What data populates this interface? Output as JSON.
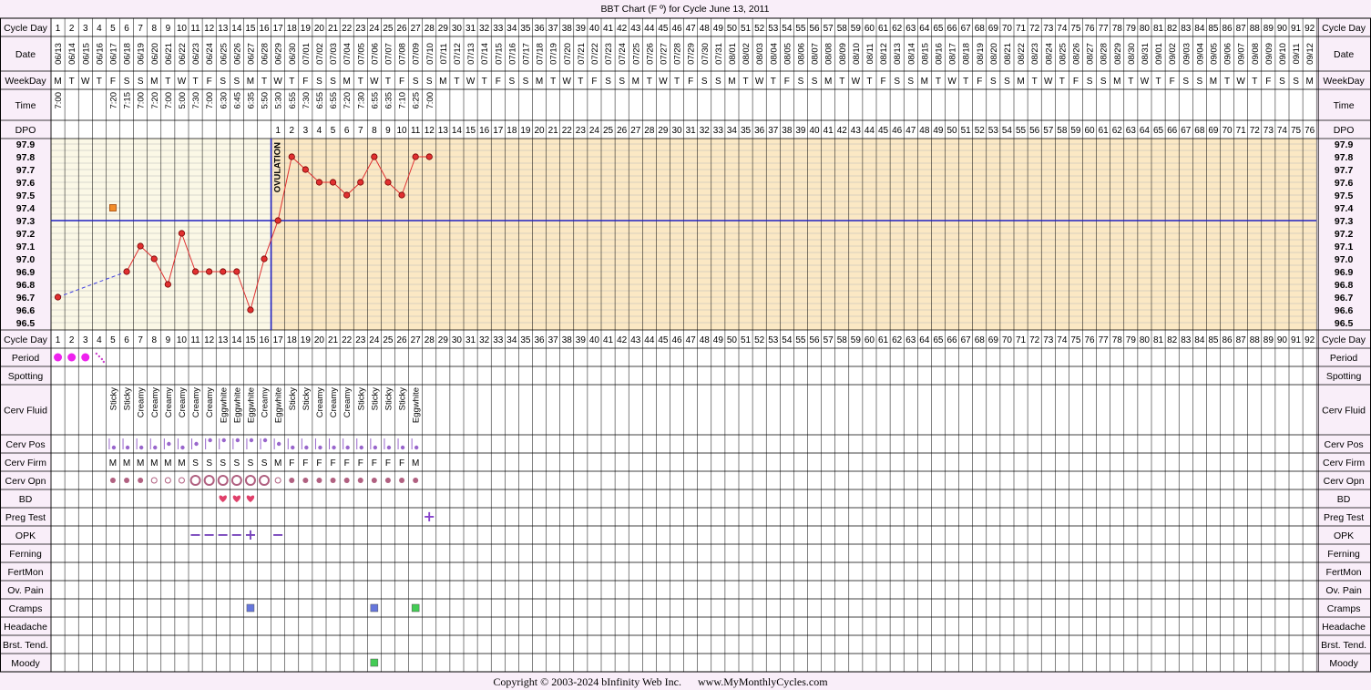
{
  "chart_data": {
    "type": "line",
    "title": "BBT Chart (F º) for Cycle June 13, 2011",
    "ylim": [
      96.5,
      97.9
    ],
    "y_ticks": [
      "97.9",
      "97.8",
      "97.7",
      "97.6",
      "97.5",
      "97.4",
      "97.3",
      "97.2",
      "97.1",
      "97.0",
      "96.9",
      "96.8",
      "96.7",
      "96.6",
      "96.5"
    ],
    "num_days": 92,
    "dates": [
      "06/13",
      "06/14",
      "06/15",
      "06/16",
      "06/17",
      "06/18",
      "06/19",
      "06/20",
      "06/21",
      "06/22",
      "06/23",
      "06/24",
      "06/25",
      "06/26",
      "06/27",
      "06/28",
      "06/29",
      "06/30",
      "07/01",
      "07/02",
      "07/03",
      "07/04",
      "07/05",
      "07/06",
      "07/07",
      "07/08",
      "07/09",
      "07/10",
      "07/11",
      "07/12",
      "07/13",
      "07/14",
      "07/15",
      "07/16",
      "07/17",
      "07/18",
      "07/19",
      "07/20",
      "07/21",
      "07/22",
      "07/23",
      "07/24",
      "07/25",
      "07/26",
      "07/27",
      "07/28",
      "07/29",
      "07/30",
      "07/31",
      "08/01",
      "08/02",
      "08/03",
      "08/04",
      "08/05",
      "08/06",
      "08/07",
      "08/08",
      "08/09",
      "08/10",
      "08/11",
      "08/12",
      "08/13",
      "08/14",
      "08/15",
      "08/16",
      "08/17",
      "08/18",
      "08/19",
      "08/20",
      "08/21",
      "08/22",
      "08/23",
      "08/24",
      "08/25",
      "08/26",
      "08/27",
      "08/28",
      "08/29",
      "08/30",
      "08/31",
      "09/01",
      "09/02",
      "09/03",
      "09/04",
      "09/05",
      "09/06",
      "09/07",
      "09/08",
      "09/09",
      "09/10",
      "09/11",
      "09/12"
    ],
    "weekday_cycle": [
      "M",
      "T",
      "W",
      "T",
      "F",
      "S",
      "S"
    ],
    "times": [
      "7:00",
      "",
      "",
      "",
      "7:20",
      "7:15",
      "7:00",
      "7:20",
      "7:00",
      "5:00",
      "7:30",
      "7:00",
      "6:30",
      "6:45",
      "6:35",
      "5:50",
      "5:30",
      "6:55",
      "7:30",
      "6:55",
      "6:55",
      "7:20",
      "7:30",
      "6:55",
      "6:35",
      "7:10",
      "6:25",
      "7:00"
    ],
    "dpo_start_day": 17,
    "dpo_max": 76,
    "temperatures": [
      {
        "day": 1,
        "temp": 96.7
      },
      {
        "day": 6,
        "temp": 96.9
      },
      {
        "day": 7,
        "temp": 97.1
      },
      {
        "day": 8,
        "temp": 97.0
      },
      {
        "day": 9,
        "temp": 96.8
      },
      {
        "day": 10,
        "temp": 97.2
      },
      {
        "day": 11,
        "temp": 96.9
      },
      {
        "day": 12,
        "temp": 96.9
      },
      {
        "day": 13,
        "temp": 96.9
      },
      {
        "day": 14,
        "temp": 96.9
      },
      {
        "day": 15,
        "temp": 96.6
      },
      {
        "day": 16,
        "temp": 97.0
      },
      {
        "day": 17,
        "temp": 97.3
      },
      {
        "day": 18,
        "temp": 97.8
      },
      {
        "day": 19,
        "temp": 97.7
      },
      {
        "day": 20,
        "temp": 97.6
      },
      {
        "day": 21,
        "temp": 97.6
      },
      {
        "day": 22,
        "temp": 97.5
      },
      {
        "day": 23,
        "temp": 97.6
      },
      {
        "day": 24,
        "temp": 97.8
      },
      {
        "day": 25,
        "temp": 97.6
      },
      {
        "day": 26,
        "temp": 97.5
      },
      {
        "day": 27,
        "temp": 97.8
      },
      {
        "day": 28,
        "temp": 97.8
      }
    ],
    "discarded": [
      {
        "day": 5,
        "temp": 97.4
      }
    ],
    "coverline": 97.3,
    "ovulation_day": 16,
    "ovulation_label": "OVULATION",
    "colors": {
      "follicular": "#fbf8e6",
      "luteal": "#fbe8c4",
      "line": "#e03030",
      "coverline": "#2020c0",
      "header": "#f9eef9",
      "dashed": "#4040e0"
    }
  },
  "labels": {
    "cycle_day": "Cycle Day",
    "date": "Date",
    "weekday": "WeekDay",
    "time": "Time",
    "dpo": "DPO",
    "period": "Period",
    "spotting": "Spotting",
    "cerv_fluid": "Cerv Fluid",
    "cerv_pos": "Cerv Pos",
    "cerv_firm": "Cerv Firm",
    "cerv_opn": "Cerv Opn",
    "bd": "BD",
    "preg_test": "Preg Test",
    "opk": "OPK",
    "ferning": "Ferning",
    "fertmon": "FertMon",
    "ov_pain": "Ov. Pain",
    "cramps": "Cramps",
    "headache": "Headache",
    "brst_tend": "Brst. Tend.",
    "moody": "Moody"
  },
  "observations": {
    "period": [
      {
        "day": 1,
        "kind": "heavy"
      },
      {
        "day": 2,
        "kind": "heavy"
      },
      {
        "day": 3,
        "kind": "heavy"
      },
      {
        "day": 4,
        "kind": "spot"
      }
    ],
    "cerv_fluid": [
      {
        "day": 5,
        "v": "Sticky"
      },
      {
        "day": 6,
        "v": "Sticky"
      },
      {
        "day": 7,
        "v": "Creamy"
      },
      {
        "day": 8,
        "v": "Creamy"
      },
      {
        "day": 9,
        "v": "Creamy"
      },
      {
        "day": 10,
        "v": "Creamy"
      },
      {
        "day": 11,
        "v": "Creamy"
      },
      {
        "day": 12,
        "v": "Creamy"
      },
      {
        "day": 13,
        "v": "Eggwhite"
      },
      {
        "day": 14,
        "v": "Eggwhite"
      },
      {
        "day": 15,
        "v": "Eggwhite"
      },
      {
        "day": 16,
        "v": "Creamy"
      },
      {
        "day": 17,
        "v": "Eggwhite"
      },
      {
        "day": 18,
        "v": "Sticky"
      },
      {
        "day": 19,
        "v": "Sticky"
      },
      {
        "day": 20,
        "v": "Creamy"
      },
      {
        "day": 21,
        "v": "Creamy"
      },
      {
        "day": 22,
        "v": "Creamy"
      },
      {
        "day": 23,
        "v": "Sticky"
      },
      {
        "day": 24,
        "v": "Sticky"
      },
      {
        "day": 25,
        "v": "Sticky"
      },
      {
        "day": 26,
        "v": "Sticky"
      },
      {
        "day": 27,
        "v": "Eggwhite"
      }
    ],
    "cerv_pos": [
      {
        "day": 5,
        "v": "low"
      },
      {
        "day": 6,
        "v": "low"
      },
      {
        "day": 7,
        "v": "low"
      },
      {
        "day": 8,
        "v": "low"
      },
      {
        "day": 9,
        "v": "mid"
      },
      {
        "day": 10,
        "v": "low"
      },
      {
        "day": 11,
        "v": "mid"
      },
      {
        "day": 12,
        "v": "high"
      },
      {
        "day": 13,
        "v": "high"
      },
      {
        "day": 14,
        "v": "high"
      },
      {
        "day": 15,
        "v": "high"
      },
      {
        "day": 16,
        "v": "high"
      },
      {
        "day": 17,
        "v": "mid"
      },
      {
        "day": 18,
        "v": "low"
      },
      {
        "day": 19,
        "v": "low"
      },
      {
        "day": 20,
        "v": "low"
      },
      {
        "day": 21,
        "v": "low"
      },
      {
        "day": 22,
        "v": "low"
      },
      {
        "day": 23,
        "v": "low"
      },
      {
        "day": 24,
        "v": "low"
      },
      {
        "day": 25,
        "v": "low"
      },
      {
        "day": 26,
        "v": "low"
      },
      {
        "day": 27,
        "v": "low"
      }
    ],
    "cerv_firm": [
      {
        "day": 5,
        "v": "M"
      },
      {
        "day": 6,
        "v": "M"
      },
      {
        "day": 7,
        "v": "M"
      },
      {
        "day": 8,
        "v": "M"
      },
      {
        "day": 9,
        "v": "M"
      },
      {
        "day": 10,
        "v": "M"
      },
      {
        "day": 11,
        "v": "S"
      },
      {
        "day": 12,
        "v": "S"
      },
      {
        "day": 13,
        "v": "S"
      },
      {
        "day": 14,
        "v": "S"
      },
      {
        "day": 15,
        "v": "S"
      },
      {
        "day": 16,
        "v": "S"
      },
      {
        "day": 17,
        "v": "M"
      },
      {
        "day": 18,
        "v": "F"
      },
      {
        "day": 19,
        "v": "F"
      },
      {
        "day": 20,
        "v": "F"
      },
      {
        "day": 21,
        "v": "F"
      },
      {
        "day": 22,
        "v": "F"
      },
      {
        "day": 23,
        "v": "F"
      },
      {
        "day": 24,
        "v": "F"
      },
      {
        "day": 25,
        "v": "F"
      },
      {
        "day": 26,
        "v": "F"
      },
      {
        "day": 27,
        "v": "M"
      }
    ],
    "cerv_opn": [
      {
        "day": 5,
        "v": "closed"
      },
      {
        "day": 6,
        "v": "closed"
      },
      {
        "day": 7,
        "v": "closed"
      },
      {
        "day": 8,
        "v": "medium"
      },
      {
        "day": 9,
        "v": "medium"
      },
      {
        "day": 10,
        "v": "medium"
      },
      {
        "day": 11,
        "v": "open"
      },
      {
        "day": 12,
        "v": "open"
      },
      {
        "day": 13,
        "v": "open"
      },
      {
        "day": 14,
        "v": "open"
      },
      {
        "day": 15,
        "v": "open"
      },
      {
        "day": 16,
        "v": "open"
      },
      {
        "day": 17,
        "v": "medium"
      },
      {
        "day": 18,
        "v": "closed"
      },
      {
        "day": 19,
        "v": "closed"
      },
      {
        "day": 20,
        "v": "closed"
      },
      {
        "day": 21,
        "v": "closed"
      },
      {
        "day": 22,
        "v": "closed"
      },
      {
        "day": 23,
        "v": "closed"
      },
      {
        "day": 24,
        "v": "closed"
      },
      {
        "day": 25,
        "v": "closed"
      },
      {
        "day": 26,
        "v": "closed"
      },
      {
        "day": 27,
        "v": "closed"
      }
    ],
    "bd": [
      13,
      14,
      15
    ],
    "preg_test": [
      {
        "day": 28,
        "v": "+"
      }
    ],
    "opk": [
      {
        "day": 11,
        "v": "−"
      },
      {
        "day": 12,
        "v": "−"
      },
      {
        "day": 13,
        "v": "−"
      },
      {
        "day": 14,
        "v": "−"
      },
      {
        "day": 15,
        "v": "+"
      },
      {
        "day": 17,
        "v": "−"
      }
    ],
    "cramps": [
      {
        "day": 15,
        "color": "#6677dd"
      },
      {
        "day": 24,
        "color": "#6677dd"
      },
      {
        "day": 27,
        "color": "#44cc55"
      }
    ],
    "moody": [
      {
        "day": 24,
        "color": "#44cc55"
      }
    ]
  },
  "footer": {
    "copyright": "Copyright © 2003-2024 bInfinity Web Inc.",
    "site": "www.MyMonthlyCycles.com"
  }
}
